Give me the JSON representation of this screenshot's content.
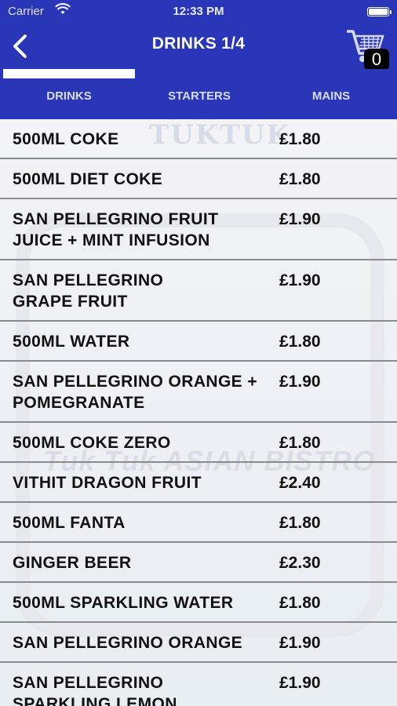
{
  "status_bar": {
    "carrier": "Carrier",
    "time": "12:33 PM"
  },
  "nav": {
    "title": "DRINKS  1/4",
    "back_icon": "chevron-left-icon",
    "cart_icon": "shopping-cart-icon",
    "cart_count": "0"
  },
  "tabs": [
    "DRINKS",
    "STARTERS",
    "MAINS"
  ],
  "active_tab": "DRINKS",
  "watermark": "TUKTUK",
  "watermark2": "Tuk Tuk  ASIAN BISTRO",
  "colors": {
    "brand": "#2a36b8",
    "divider": "#8a8a8a"
  },
  "items": [
    {
      "name": "500ML COKE",
      "price": "£1.80"
    },
    {
      "name": "500ML DIET COKE",
      "price": "£1.80"
    },
    {
      "name": "SAN PELLEGRINO FRUIT JUICE + MINT INFUSION",
      "price": "£1.90"
    },
    {
      "name": "SAN PELLEGRINO GRAPE FRUIT",
      "price": "£1.90"
    },
    {
      "name": "500ML WATER",
      "price": "£1.80"
    },
    {
      "name": "SAN PELLEGRINO ORANGE + POMEGRANATE",
      "price": "£1.90"
    },
    {
      "name": "500ML COKE ZERO",
      "price": "£1.80"
    },
    {
      "name": "VITHIT DRAGON FRUIT",
      "price": "£2.40"
    },
    {
      "name": "500ML FANTA",
      "price": "£1.80"
    },
    {
      "name": "GINGER BEER",
      "price": "£2.30"
    },
    {
      "name": "500ML SPARKLING WATER",
      "price": "£1.80"
    },
    {
      "name": "SAN PELLEGRINO ORANGE",
      "price": "£1.90"
    },
    {
      "name": "SAN PELLEGRINO SPARKLING LEMON",
      "price": "£1.90"
    }
  ]
}
